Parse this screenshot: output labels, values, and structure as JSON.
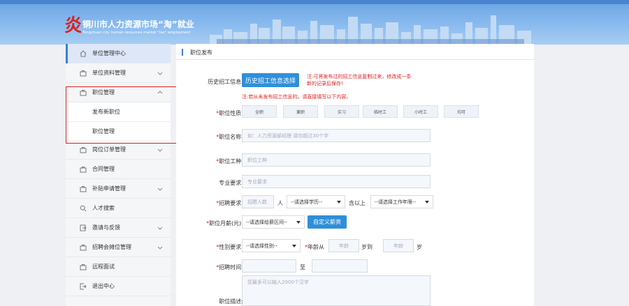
{
  "banner": {
    "logo_char": "炎",
    "title": "铜川市人力资源市场“淘”就业",
    "subtitle": "Tongchuan city human resources market \"tao\" employment"
  },
  "sidebar": {
    "items": [
      {
        "label": "单位管理中心",
        "icon": "home-icon"
      },
      {
        "label": "单位资料管理",
        "icon": "briefcase-icon"
      },
      {
        "label": "职位管理",
        "icon": "briefcase-icon"
      },
      {
        "label": "岗位订单管理",
        "icon": "briefcase-icon"
      },
      {
        "label": "合同管理",
        "icon": "briefcase-icon"
      },
      {
        "label": "补贴申请管理",
        "icon": "briefcase-icon"
      },
      {
        "label": "人才搜索",
        "icon": "search-icon"
      },
      {
        "label": "邀请与反馈",
        "icon": "invite-icon"
      },
      {
        "label": "招聘会摊位管理",
        "icon": "briefcase-icon"
      },
      {
        "label": "远程面试",
        "icon": "briefcase-icon"
      },
      {
        "label": "退出中心",
        "icon": "logout-icon"
      }
    ],
    "subitems": [
      {
        "label": "发布新职位"
      },
      {
        "label": "职位管理"
      }
    ]
  },
  "main": {
    "title": "职位发布",
    "history_label": "历史招工信息:",
    "history_button": "历史招工信息选择",
    "history_note": "注:可将发布过的招工信息复制过来，修改成一条新的记录后保存!",
    "history_note_line1": "注:可将发布过的招工信息复制过来，修改成一条",
    "history_note_line2": "新的记录后保存!",
    "first_note": "注:若从未发布招工信息的，请直接填写以下内容。",
    "nature_label": "职位性质:",
    "nature_options": [
      "全职",
      "兼职",
      "实习",
      "临时工",
      "小时工",
      "均可"
    ],
    "name_label": "职位名称:",
    "name_placeholder": "如：人力资源部经理 请勿超过30个字",
    "type_label": "职位工种:",
    "type_placeholder": "职位工种",
    "major_label": "专业要求:",
    "major_placeholder": "专业要求",
    "recruit_label": "招聘要求:",
    "recruit_count_placeholder": "招聘人数",
    "recruit_unit": "人",
    "education_select": "--请选择学历--",
    "education_suffix": "含以上",
    "experience_select": "--请选择工作年限--",
    "salary_label": "职位月薪(元):",
    "salary_select": "--请选择给薪区间--",
    "salary_custom_button": "自定义薪资",
    "gender_label": "性别要求:",
    "gender_select": "--请选择性别--",
    "age_label": "年龄从",
    "age_from_placeholder": "年龄",
    "age_mid": "岁到",
    "age_to_placeholder": "年龄",
    "age_suffix": "岁",
    "time_label": "招聘时间:",
    "time_to": "至",
    "desc_label": "职位描述:",
    "desc_placeholder": "您最多可以输入2000个汉字"
  },
  "colors": {
    "accent": "#2f8fd8",
    "required": "#e02020",
    "highlight_border": "#e02020",
    "banner": "#6fa8e6"
  }
}
